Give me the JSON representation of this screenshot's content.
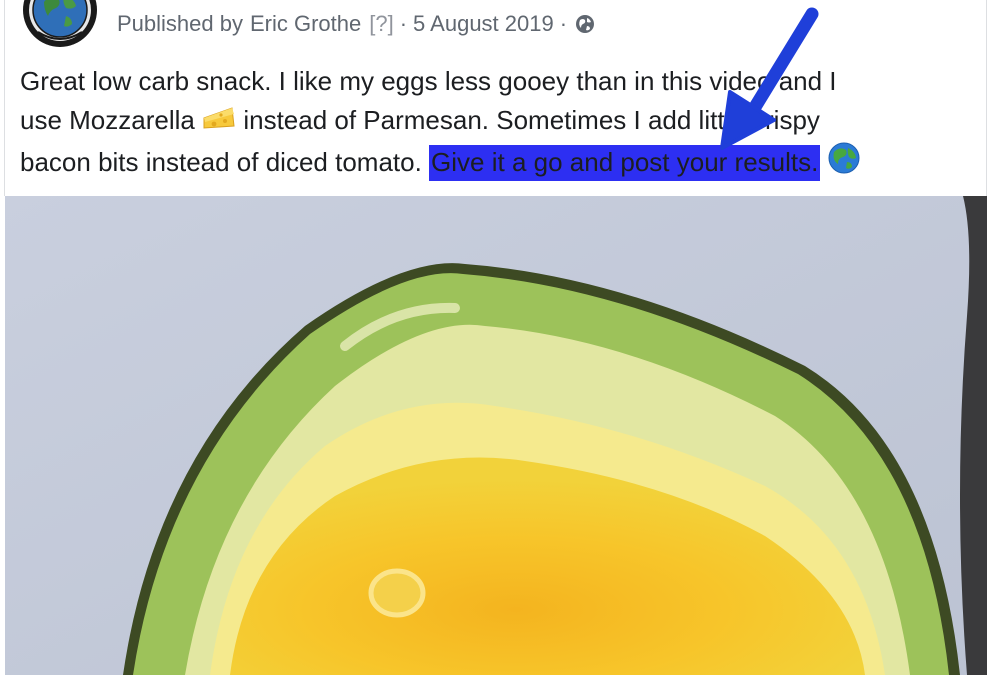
{
  "post": {
    "published_prefix": "Published by",
    "author": "Eric Grothe",
    "help_marker": "[?]",
    "separator": "·",
    "date": "5 August 2019",
    "privacy_icon": "globe-icon"
  },
  "body": {
    "line1": "Great low carb snack. I like my eggs less gooey than in this video and I",
    "line2a": "use Mozzarella",
    "line2b": "instead of Parmesan. Sometimes I add little crispy",
    "line3a": "bacon bits instead of diced tomato.",
    "highlighted": "Give it a go and post your results.",
    "emoji_cheese": "cheese-emoji",
    "emoji_globe": "globe-earth-emoji"
  },
  "colors": {
    "highlight": "#2d2ff2",
    "annotation_arrow": "#1f3fd9",
    "meta_text": "#606770",
    "body_text": "#1c1e21"
  }
}
